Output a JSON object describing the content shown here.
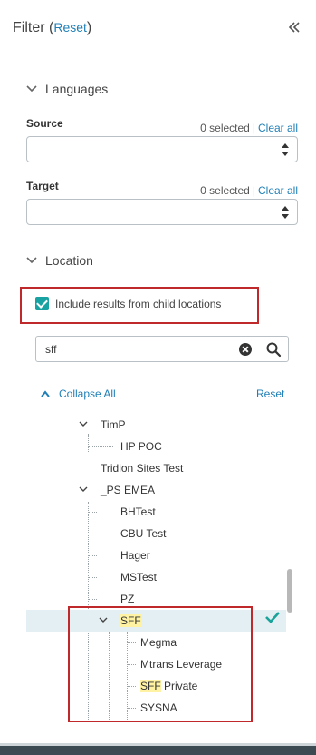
{
  "header": {
    "title": "Filter",
    "reset_label": "Reset",
    "open_paren": "(",
    "close_paren": ")"
  },
  "icons": {
    "collapse_panel": "double-chevron-left-icon",
    "section_toggle": "chevron-down-icon",
    "search": "search-icon",
    "clear": "clear-circle-icon",
    "selected": "checkmark-icon"
  },
  "colors": {
    "accent": "#1f7fb6",
    "checkbox": "#18a2a2",
    "highlight_border": "#c0292b",
    "search_match": "#fff3a3",
    "selected_row": "#e3eff2",
    "check_mark": "#1aa39a"
  },
  "languages": {
    "title": "Languages",
    "source": {
      "label": "Source",
      "selected": "0 selected",
      "separator": "|",
      "clear": "Clear all"
    },
    "target": {
      "label": "Target",
      "selected": "0 selected",
      "separator": "|",
      "clear": "Clear all"
    }
  },
  "location": {
    "title": "Location",
    "include_children_label": "Include results from child locations",
    "include_children_checked": true,
    "search_value": "sff",
    "collapse_all_label": "Collapse All",
    "reset_label": "Reset",
    "tree": [
      {
        "label": "TimP"
      },
      {
        "label": "HP POC"
      },
      {
        "label": "Tridion Sites Test"
      },
      {
        "label": "_PS EMEA"
      },
      {
        "label": "BHTest"
      },
      {
        "label": "CBU Test"
      },
      {
        "label": "Hager"
      },
      {
        "label": "MSTest"
      },
      {
        "label": "PZ"
      },
      {
        "label": "SFF",
        "match": "SFF",
        "selected": true
      },
      {
        "label": "Megma"
      },
      {
        "label": "Mtrans Leverage"
      },
      {
        "label": "SFF Private",
        "match": "SFF",
        "rest": " Private"
      },
      {
        "label": "SYSNA"
      }
    ]
  }
}
